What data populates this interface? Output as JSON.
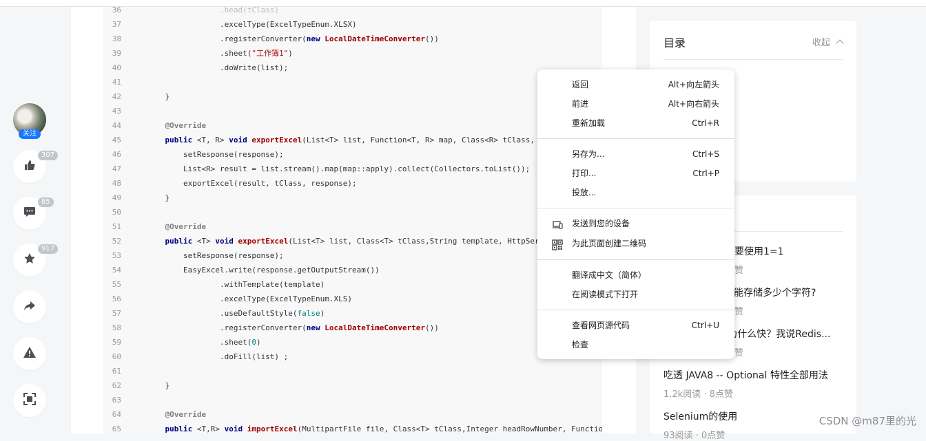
{
  "sidebar": {
    "follow_label": "关注",
    "like_count": "307",
    "comment_count": "85",
    "collect_count": "917",
    "icons": [
      "thumbs-up-icon",
      "comment-icon",
      "star-icon",
      "share-icon",
      "warning-icon",
      "fullscreen-icon"
    ]
  },
  "code_lines": [
    {
      "n": "36",
      "html": "<span class=\"faded\">                .head(tClass)</span>"
    },
    {
      "n": "37",
      "html": "                .excelType(ExcelTypeEnum.XLSX)"
    },
    {
      "n": "38",
      "html": "                .registerConverter(<span class=\"kw\">new</span> <span class=\"fn\">LocalDateTimeConverter</span>())"
    },
    {
      "n": "39",
      "html": "                .sheet(<span class=\"str\">\"工作簿1\"</span>)"
    },
    {
      "n": "40",
      "html": "                .doWrite(list);"
    },
    {
      "n": "41",
      "html": ""
    },
    {
      "n": "42",
      "html": "    }"
    },
    {
      "n": "43",
      "html": ""
    },
    {
      "n": "44",
      "html": "    <span class=\"ann\">@Override</span>"
    },
    {
      "n": "45",
      "html": "    <span class=\"kw\">public</span> &lt;T, R&gt; <span class=\"kw\">void</span> <span class=\"fn\">exportExcel</span>(List&lt;T&gt; list, Function&lt;T, R&gt; map, Class&lt;R&gt; tClass, HttpServl"
    },
    {
      "n": "46",
      "html": "        setResponse(response);"
    },
    {
      "n": "47",
      "html": "        List&lt;R&gt; result = list.stream().map(map::apply).collect(Collectors.toList());"
    },
    {
      "n": "48",
      "html": "        exportExcel(result, tClass, response);"
    },
    {
      "n": "49",
      "html": "    }"
    },
    {
      "n": "50",
      "html": ""
    },
    {
      "n": "51",
      "html": "    <span class=\"ann\">@Override</span>"
    },
    {
      "n": "52",
      "html": "    <span class=\"kw\">public</span> &lt;T&gt; <span class=\"kw\">void</span> <span class=\"fn\">exportExcel</span>(List&lt;T&gt; list, Class&lt;T&gt; tClass,String template, HttpServletRespo"
    },
    {
      "n": "53",
      "html": "        setResponse(response);"
    },
    {
      "n": "54",
      "html": "        EasyExcel.write(response.getOutputStream())"
    },
    {
      "n": "55",
      "html": "                .withTemplate(template)"
    },
    {
      "n": "56",
      "html": "                .excelType(ExcelTypeEnum.XLS)"
    },
    {
      "n": "57",
      "html": "                .useDefaultStyle(<span class=\"lit\">false</span>)"
    },
    {
      "n": "58",
      "html": "                .registerConverter(<span class=\"kw\">new</span> <span class=\"fn\">LocalDateTimeConverter</span>())"
    },
    {
      "n": "59",
      "html": "                .sheet(<span class=\"lit\">0</span>)"
    },
    {
      "n": "60",
      "html": "                .doFill(list) ;"
    },
    {
      "n": "61",
      "html": ""
    },
    {
      "n": "62",
      "html": "    }"
    },
    {
      "n": "63",
      "html": ""
    },
    {
      "n": "64",
      "html": "    <span class=\"ann\">@Override</span>"
    },
    {
      "n": "65",
      "html": "    <span class=\"kw\">public</span> &lt;T,R&gt; <span class=\"kw\">void</span> <span class=\"fn\">importExcel</span>(MultipartFile file, Class&lt;T&gt; tClass,Integer headRowNumber, Function&lt;T, R&gt; map"
    }
  ],
  "toc": {
    "title": "目录",
    "collapse_label": "收起"
  },
  "hot_articles": [
    {
      "title": "要使用1=1",
      "meta": "赞"
    },
    {
      "title": "够能存储多少个字符?",
      "meta": "赞"
    },
    {
      "title": "s为什么快？我说Redis...",
      "meta": "赞"
    },
    {
      "title": "吃透 JAVA8 -- Optional 特性全部用法",
      "meta": "1.2k阅读 · 8点赞"
    },
    {
      "title": "Selenium的使用",
      "meta": "93阅读 · 0点赞"
    }
  ],
  "context_menu": {
    "back": {
      "label": "返回",
      "shortcut": "Alt+向左箭头"
    },
    "forward": {
      "label": "前进",
      "shortcut": "Alt+向右箭头"
    },
    "reload": {
      "label": "重新加载",
      "shortcut": "Ctrl+R"
    },
    "save_as": {
      "label": "另存为...",
      "shortcut": "Ctrl+S"
    },
    "print": {
      "label": "打印...",
      "shortcut": "Ctrl+P"
    },
    "cast": {
      "label": "投放..."
    },
    "send_to_device": {
      "label": "发送到您的设备",
      "icon": "device-send-icon"
    },
    "qr_code": {
      "label": "为此页面创建二维码",
      "icon": "qr-code-icon"
    },
    "translate": {
      "label": "翻译成中文（简体）"
    },
    "reader_mode": {
      "label": "在阅读模式下打开"
    },
    "view_source": {
      "label": "查看网页源代码",
      "shortcut": "Ctrl+U"
    },
    "inspect": {
      "label": "检查"
    }
  },
  "watermark": "CSDN @m87里的光"
}
